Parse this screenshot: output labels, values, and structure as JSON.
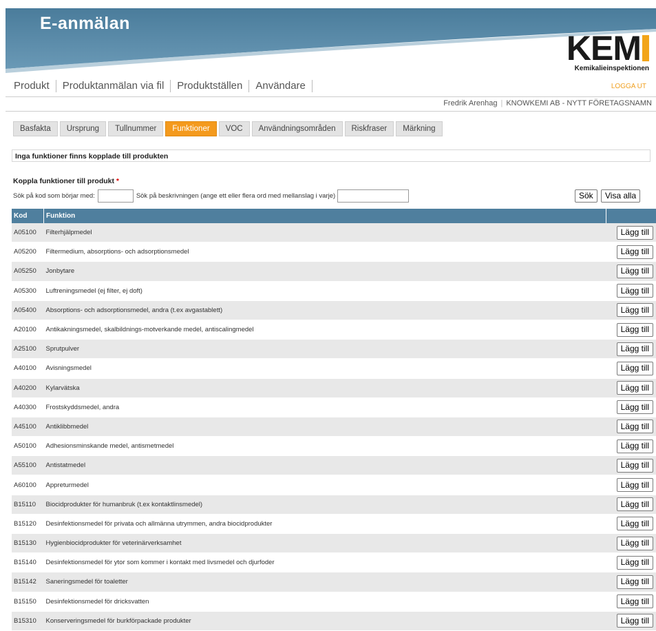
{
  "app_title": "E-anmälan",
  "logo": {
    "text": "KEM",
    "subtitle": "Kemikalieinspektionen",
    "accent": "#f2a51a"
  },
  "nav": {
    "items": [
      "Produkt",
      "Produktanmälan via fil",
      "Produktställen",
      "Användare"
    ],
    "logout": "LOGGA UT"
  },
  "user": {
    "name": "Fredrik Arenhag",
    "company": "KNOWKEMI AB - NYTT FÖRETAGSNAMN"
  },
  "tabs": [
    "Basfakta",
    "Ursprung",
    "Tullnummer",
    "Funktioner",
    "VOC",
    "Användningsområden",
    "Riskfraser",
    "Märkning"
  ],
  "active_tab": "Funktioner",
  "notice": "Inga funktioner finns kopplade till produkten",
  "section_title": "Koppla funktioner till produkt",
  "required_mark": "*",
  "search": {
    "code_label": "Sök på kod som börjar med:",
    "code_value": "",
    "desc_label": "Sök på beskrivningen (ange ett eller flera ord med mellanslag i varje)",
    "desc_value": "",
    "search_button": "Sök",
    "show_all_button": "Visa alla"
  },
  "table": {
    "headers": [
      "Kod",
      "Funktion",
      ""
    ],
    "add_label": "Lägg till",
    "rows": [
      {
        "kod": "A05100",
        "funktion": "Filterhjälpmedel"
      },
      {
        "kod": "A05200",
        "funktion": "Filtermedium, absorptions- och adsorptionsmedel"
      },
      {
        "kod": "A05250",
        "funktion": "Jonbytare"
      },
      {
        "kod": "A05300",
        "funktion": "Luftreningsmedel (ej filter, ej doft)"
      },
      {
        "kod": "A05400",
        "funktion": "Absorptions- och adsorptionsmedel, andra (t.ex avgastablett)"
      },
      {
        "kod": "A20100",
        "funktion": "Antikakningsmedel, skalbildnings-motverkande medel, antiscalingmedel"
      },
      {
        "kod": "A25100",
        "funktion": "Sprutpulver"
      },
      {
        "kod": "A40100",
        "funktion": "Avisningsmedel"
      },
      {
        "kod": "A40200",
        "funktion": "Kylarvätska"
      },
      {
        "kod": "A40300",
        "funktion": "Frostskyddsmedel, andra"
      },
      {
        "kod": "A45100",
        "funktion": "Antiklibbmedel"
      },
      {
        "kod": "A50100",
        "funktion": "Adhesionsminskande medel, antismetmedel"
      },
      {
        "kod": "A55100",
        "funktion": "Antistatmedel"
      },
      {
        "kod": "A60100",
        "funktion": "Appreturmedel"
      },
      {
        "kod": "B15110",
        "funktion": "Biocidprodukter för humanbruk (t.ex kontaktlinsmedel)"
      },
      {
        "kod": "B15120",
        "funktion": "Desinfektionsmedel för privata och allmänna utrymmen, andra biocidprodukter"
      },
      {
        "kod": "B15130",
        "funktion": "Hygienbiocidprodukter för veterinärverksamhet"
      },
      {
        "kod": "B15140",
        "funktion": "Desinfektionsmedel för ytor som kommer i kontakt med livsmedel och djurfoder"
      },
      {
        "kod": "B15142",
        "funktion": "Saneringsmedel för toaletter"
      },
      {
        "kod": "B15150",
        "funktion": "Desinfektionsmedel för dricksvatten"
      },
      {
        "kod": "B15310",
        "funktion": "Konserveringsmedel för burkförpackade produkter"
      }
    ]
  }
}
